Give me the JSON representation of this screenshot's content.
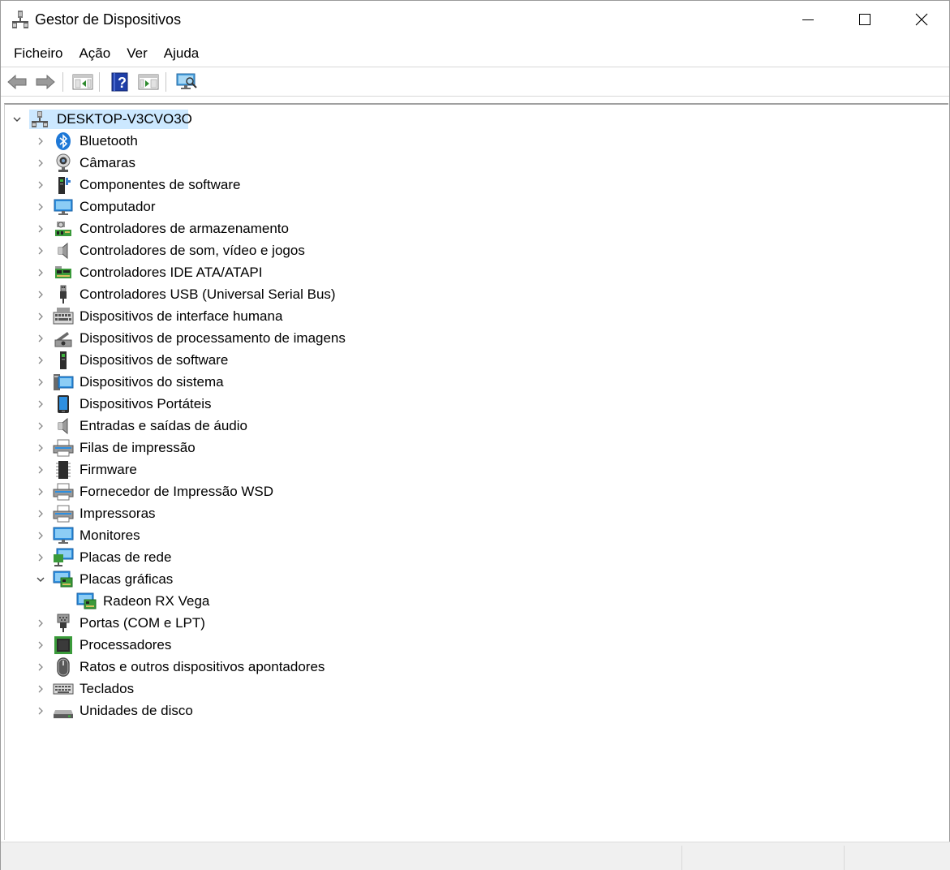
{
  "window": {
    "title": "Gestor de Dispositivos"
  },
  "menu": [
    "Ficheiro",
    "Ação",
    "Ver",
    "Ajuda"
  ],
  "toolbar": {
    "buttons": [
      "back-arrow-icon",
      "forward-arrow-icon",
      "show-hide-console-tree-icon",
      "help-icon",
      "action-pane-icon",
      "scan-hardware-icon"
    ]
  },
  "tree": {
    "root": "DESKTOP-V3CVO3O",
    "categories": [
      {
        "label": "Bluetooth",
        "icon": "bluetooth-icon",
        "expanded": false
      },
      {
        "label": "Câmaras",
        "icon": "camera-icon",
        "expanded": false
      },
      {
        "label": "Componentes de software",
        "icon": "software-component-icon",
        "expanded": false
      },
      {
        "label": "Computador",
        "icon": "computer-icon",
        "expanded": false
      },
      {
        "label": "Controladores de armazenamento",
        "icon": "storage-controller-icon",
        "expanded": false
      },
      {
        "label": "Controladores de som, vídeo e jogos",
        "icon": "speaker-icon",
        "expanded": false
      },
      {
        "label": "Controladores IDE ATA/ATAPI",
        "icon": "ide-controller-icon",
        "expanded": false
      },
      {
        "label": "Controladores USB (Universal Serial Bus)",
        "icon": "usb-icon",
        "expanded": false
      },
      {
        "label": "Dispositivos de interface humana",
        "icon": "hid-icon",
        "expanded": false
      },
      {
        "label": "Dispositivos de processamento de imagens",
        "icon": "imaging-device-icon",
        "expanded": false
      },
      {
        "label": "Dispositivos de software",
        "icon": "software-device-icon",
        "expanded": false
      },
      {
        "label": "Dispositivos do sistema",
        "icon": "system-device-icon",
        "expanded": false
      },
      {
        "label": "Dispositivos Portáteis",
        "icon": "portable-device-icon",
        "expanded": false
      },
      {
        "label": "Entradas e saídas de áudio",
        "icon": "audio-io-icon",
        "expanded": false
      },
      {
        "label": "Filas de impressão",
        "icon": "print-queue-icon",
        "expanded": false
      },
      {
        "label": "Firmware",
        "icon": "firmware-icon",
        "expanded": false
      },
      {
        "label": "Fornecedor de Impressão WSD",
        "icon": "wsd-printer-icon",
        "expanded": false
      },
      {
        "label": "Impressoras",
        "icon": "printer-icon",
        "expanded": false
      },
      {
        "label": "Monitores",
        "icon": "monitor-icon",
        "expanded": false
      },
      {
        "label": "Placas de rede",
        "icon": "network-adapter-icon",
        "expanded": false
      },
      {
        "label": "Placas gráficas",
        "icon": "display-adapter-icon",
        "expanded": true,
        "children": [
          "Radeon RX Vega"
        ]
      },
      {
        "label": "Portas (COM e LPT)",
        "icon": "port-icon",
        "expanded": false
      },
      {
        "label": "Processadores",
        "icon": "processor-icon",
        "expanded": false
      },
      {
        "label": "Ratos e outros dispositivos apontadores",
        "icon": "mouse-icon",
        "expanded": false
      },
      {
        "label": "Teclados",
        "icon": "keyboard-icon",
        "expanded": false
      },
      {
        "label": "Unidades de disco",
        "icon": "disk-drive-icon",
        "expanded": false
      }
    ]
  },
  "colors": {
    "selection": "#cce8ff",
    "accent_blue": "#1e78d7",
    "chip_green": "#3a9a3a"
  }
}
